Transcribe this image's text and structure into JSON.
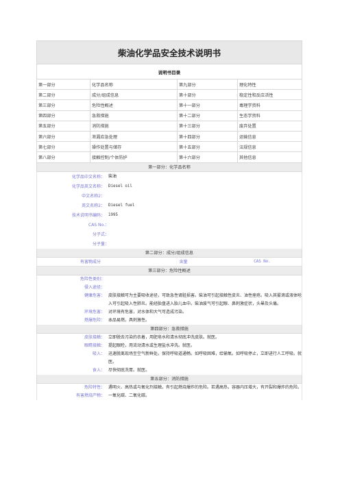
{
  "title": "柴油化学品安全技术说明书",
  "toc_heading": "说明书目录",
  "toc": [
    [
      "第一部分",
      "化学品名称",
      "第九部分",
      "理化特性"
    ],
    [
      "第二部分",
      "成分/组成信息",
      "第十部分",
      "稳定性和反应活性"
    ],
    [
      "第三部分",
      "危险性概述",
      "第十一部分",
      "毒理学资料"
    ],
    [
      "第四部分",
      "急救措施",
      "第十二部分",
      "生态学资料"
    ],
    [
      "第五部分",
      "消防措施",
      "第十三部分",
      "废弃处置"
    ],
    [
      "第六部分",
      "泄漏应急处理",
      "第十四部分",
      "运输信息"
    ],
    [
      "第七部分",
      "操作处置与储存",
      "第十五部分",
      "法规信息"
    ],
    [
      "第八部分",
      "接触控制/个体防护",
      "第十六部分",
      "其他信息"
    ]
  ],
  "part1": {
    "heading": "第一部分：化学品名称",
    "rows": [
      {
        "label": "化学品中文名称：",
        "value": "柴油"
      },
      {
        "label": "化学品英文名称：",
        "value": "Diesel oil"
      },
      {
        "label": "中文名称2：",
        "value": ""
      },
      {
        "label": "英文名称2：",
        "value": "Diesel fuel"
      },
      {
        "label": "技术说明书编码：",
        "value": "1995"
      },
      {
        "label": "CAS No.：",
        "value": ""
      },
      {
        "label": "分子式：",
        "value": ""
      },
      {
        "label": "分子量：",
        "value": ""
      }
    ]
  },
  "part2": {
    "heading": "第二部分：成分/组成信息",
    "col1": "有害物成分",
    "col2": "含量",
    "col3": "CAS No."
  },
  "part3": {
    "heading": "第三部分：危险性概述",
    "rows": [
      {
        "label": "危险性类别：",
        "value": ""
      },
      {
        "label": "侵入途径：",
        "value": ""
      },
      {
        "label": "健康危害：",
        "value": "皮肤接触可为主要吸收途径，可致急性肾脏损害。柴油可引起接触性皮炎、油性痤疮。吸入其雾滴或液体呛入可引起吸入性肺炎。能经胎盘进入胎儿血中。柴油废气可引起眼、鼻刺激症状，头晕及头痛。"
      },
      {
        "label": "环境危害：",
        "value": "对环境有危害，对水体和大气可造成污染。"
      },
      {
        "label": "燃爆危险：",
        "value": "本品易燃，具刺激性。"
      }
    ]
  },
  "part4": {
    "heading": "第四部分：急救措施",
    "rows": [
      {
        "label": "皮肤接触：",
        "value": "立即脱去污染的衣着，用肥皂水和清水彻底冲洗皮肤。就医。"
      },
      {
        "label": "眼睛接触：",
        "value": "提起眼睑，用流动清水或生理盐水冲洗。就医。"
      },
      {
        "label": "吸入：",
        "value": "迅速脱离现场至空气新鲜处。保持呼吸道通畅。如呼吸困难，给输氧。如呼吸停止，立即进行人工呼吸。就医。"
      },
      {
        "label": "食入：",
        "value": "尽快彻底洗胃。就医。"
      }
    ]
  },
  "part5": {
    "heading": "第五部分：消防措施",
    "rows": [
      {
        "label": "危险特性：",
        "value": "遇明火、高热或与氧化剂接触，有引起燃烧爆炸的危险。若遇高热，容器内压增大，有开裂和爆炸的危险。"
      },
      {
        "label": "有害燃烧产物：",
        "value": "一氧化碳、二氧化碳。"
      }
    ]
  }
}
